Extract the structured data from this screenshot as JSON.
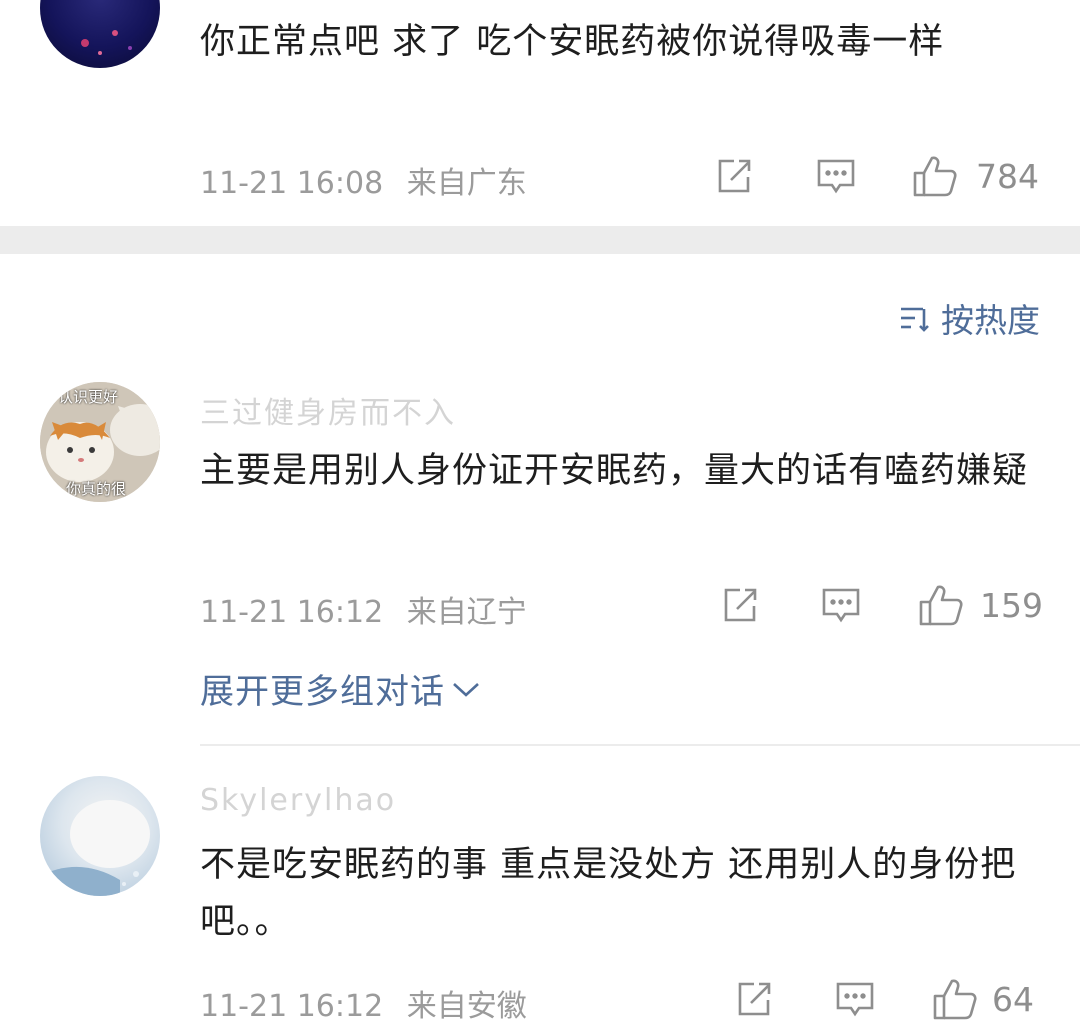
{
  "comments": [
    {
      "username": "",
      "text": "你正常点吧 求了 吃个安眠药被你说得吸毒一样",
      "time": "11-21 16:08",
      "location": "来自广东",
      "likes": "784"
    },
    {
      "username": "三过健身房而不入",
      "text": "主要是用别人身份证开安眠药，量大的话有嗑药嫌疑",
      "time": "11-21 16:12",
      "location": "来自辽宁",
      "likes": "159",
      "avatar_caption_top": "认识更好",
      "avatar_caption_bottom": "你真的很"
    },
    {
      "username": "Skylerylhao",
      "text": "不是吃安眠药的事 重点是没处方 还用别人的身份把吧。。",
      "time": "11-21 16:12",
      "location": "来自安徽",
      "likes": "64"
    }
  ],
  "sort": {
    "label": "按热度",
    "icon": "sort-icon"
  },
  "expand": {
    "label": "展开更多组对话",
    "icon": "chevron-down-icon"
  },
  "icons": {
    "share": "share-icon",
    "reply": "comment-icon",
    "like": "thumbs-up-icon"
  },
  "colors": {
    "link_blue": "#4f6d99",
    "meta_gray": "#9b9b9b",
    "divider": "#ececec"
  }
}
